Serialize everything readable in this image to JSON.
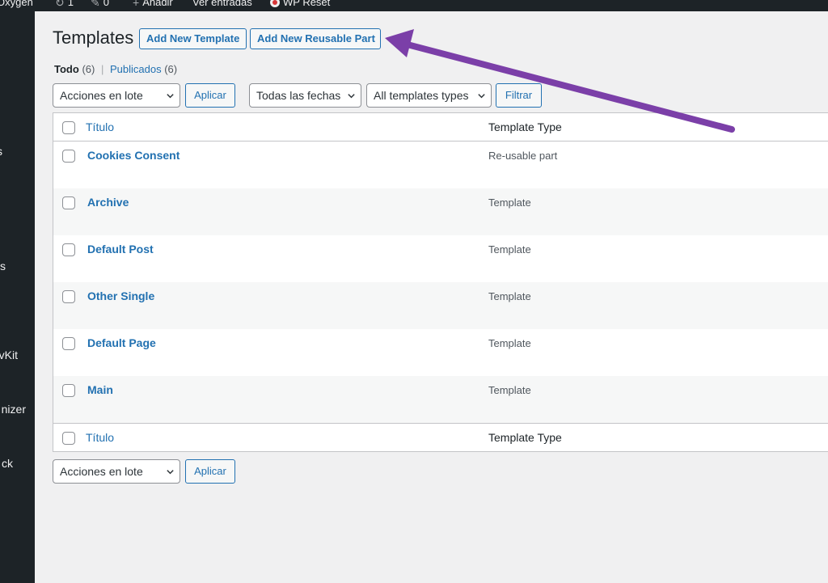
{
  "adminbar": {
    "items": [
      {
        "label": "Oxygen",
        "icon": ""
      },
      {
        "label": "1",
        "icon": "refresh-icon"
      },
      {
        "label": "0",
        "icon": "comment-icon"
      },
      {
        "label": "Añadir",
        "icon": "plus-icon"
      },
      {
        "label": "Ver entradas",
        "icon": ""
      },
      {
        "label": "WP Reset",
        "icon": "wp-reset-icon"
      }
    ]
  },
  "sidebar": {
    "items": [
      {
        "label": "s"
      },
      {
        "label": "s"
      },
      {
        "label": "vKit"
      },
      {
        "label": "nizer"
      },
      {
        "label": "ck"
      }
    ]
  },
  "page": {
    "title": "Templates",
    "add_template": "Add New Template",
    "add_reusable": "Add New Reusable Part"
  },
  "views": {
    "all_label": "Todo",
    "all_count": "(6)",
    "separator": "|",
    "published_label": "Publicados",
    "published_count": "(6)"
  },
  "filters": {
    "bulk_actions": "Acciones en lote",
    "apply": "Aplicar",
    "dates": "Todas las fechas",
    "types": "All templates types",
    "filter": "Filtrar"
  },
  "table": {
    "col_title": "Título",
    "col_type": "Template Type",
    "rows": [
      {
        "title": "Cookies Consent",
        "type": "Re-usable part"
      },
      {
        "title": "Archive",
        "type": "Template"
      },
      {
        "title": "Default Post",
        "type": "Template"
      },
      {
        "title": "Other Single",
        "type": "Template"
      },
      {
        "title": "Default Page",
        "type": "Template"
      },
      {
        "title": "Main",
        "type": "Template"
      }
    ]
  },
  "colors": {
    "accent": "#2271b1",
    "admin_dark": "#1d2327",
    "annotation_arrow": "#7b3fa8"
  }
}
